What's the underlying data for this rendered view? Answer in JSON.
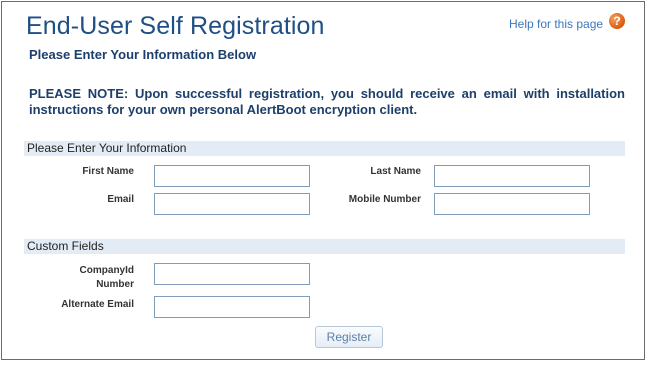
{
  "page": {
    "title": "End-User Self Registration",
    "help_link": "Help for this page",
    "help_icon": "question-icon",
    "subtitle": "Please Enter Your Information Below",
    "note": "PLEASE NOTE: Upon successful registration, you should receive an email with installation instructions for your own personal AlertBoot encryption client."
  },
  "sections": {
    "info_header": "Please Enter Your Information",
    "custom_header": "Custom Fields"
  },
  "fields": {
    "first_name": {
      "label": "First Name",
      "value": ""
    },
    "last_name": {
      "label": "Last Name",
      "value": ""
    },
    "email": {
      "label": "Email",
      "value": ""
    },
    "mobile_number": {
      "label": "Mobile Number",
      "value": ""
    },
    "company_id_line1": {
      "label": "CompanyId"
    },
    "company_id_line2": {
      "label": "Number",
      "value": ""
    },
    "alternate_email": {
      "label": "Alternate Email",
      "value": ""
    }
  },
  "actions": {
    "register_label": "Register"
  },
  "colors": {
    "title": "#1f4f86",
    "link": "#3a78c0",
    "section_bar": "#e3ebf5",
    "help_icon": "#d85a12"
  }
}
